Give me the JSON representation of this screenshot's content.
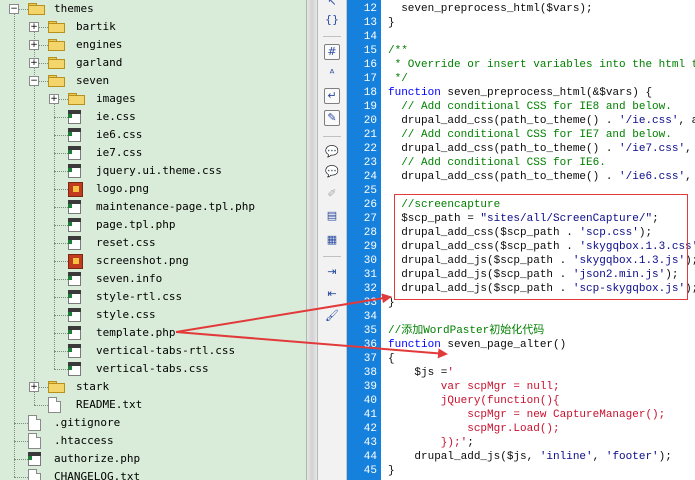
{
  "tree": {
    "items": [
      {
        "label": "themes",
        "type": "folder",
        "depth": 0,
        "expander": "−"
      },
      {
        "label": "bartik",
        "type": "folder",
        "depth": 1,
        "expander": "+"
      },
      {
        "label": "engines",
        "type": "folder",
        "depth": 1,
        "expander": "+"
      },
      {
        "label": "garland",
        "type": "folder",
        "depth": 1,
        "expander": "+"
      },
      {
        "label": "seven",
        "type": "folder",
        "depth": 1,
        "expander": "−"
      },
      {
        "label": "images",
        "type": "folder",
        "depth": 2,
        "expander": "+"
      },
      {
        "label": "ie.css",
        "type": "css",
        "depth": 2
      },
      {
        "label": "ie6.css",
        "type": "css",
        "depth": 2
      },
      {
        "label": "ie7.css",
        "type": "css",
        "depth": 2
      },
      {
        "label": "jquery.ui.theme.css",
        "type": "css",
        "depth": 2
      },
      {
        "label": "logo.png",
        "type": "image",
        "depth": 2
      },
      {
        "label": "maintenance-page.tpl.php",
        "type": "css",
        "depth": 2
      },
      {
        "label": "page.tpl.php",
        "type": "css",
        "depth": 2
      },
      {
        "label": "reset.css",
        "type": "css",
        "depth": 2
      },
      {
        "label": "screenshot.png",
        "type": "image",
        "depth": 2
      },
      {
        "label": "seven.info",
        "type": "css",
        "depth": 2
      },
      {
        "label": "style-rtl.css",
        "type": "css",
        "depth": 2
      },
      {
        "label": "style.css",
        "type": "css",
        "depth": 2
      },
      {
        "label": "template.php",
        "type": "css",
        "depth": 2
      },
      {
        "label": "vertical-tabs-rtl.css",
        "type": "css",
        "depth": 2
      },
      {
        "label": "vertical-tabs.css",
        "type": "css",
        "depth": 2
      },
      {
        "label": "stark",
        "type": "folder",
        "depth": 1,
        "expander": "+"
      },
      {
        "label": "README.txt",
        "type": "plain",
        "depth": 1
      },
      {
        "label": ".gitignore",
        "type": "plain",
        "depth": 0
      },
      {
        "label": ".htaccess",
        "type": "plain",
        "depth": 0
      },
      {
        "label": "authorize.php",
        "type": "css",
        "depth": 0
      },
      {
        "label": "CHANGELOG.txt",
        "type": "plain",
        "depth": 0
      }
    ]
  },
  "toolbar": {
    "icons": [
      {
        "name": "cursor-icon",
        "glyph": "↖"
      },
      {
        "name": "brace-match-icon",
        "glyph": "{}"
      },
      {
        "name": "line-number-toggle-icon",
        "glyph": "#"
      },
      {
        "name": "spellcheck-icon",
        "glyph": "ᴬ"
      },
      {
        "name": "word-wrap-icon",
        "glyph": "↵"
      },
      {
        "name": "highlight-icon",
        "glyph": "✎"
      },
      {
        "name": "comment-icon",
        "glyph": "💬"
      },
      {
        "name": "uncomment-icon",
        "glyph": "💬"
      },
      {
        "name": "edit-disabled-icon",
        "glyph": "✐"
      },
      {
        "name": "document-edit-icon",
        "glyph": "▤"
      },
      {
        "name": "table-icon",
        "glyph": "▦"
      },
      {
        "name": "indent-icon",
        "glyph": "⇥"
      },
      {
        "name": "outdent-icon",
        "glyph": "⇤"
      },
      {
        "name": "brush-icon",
        "glyph": "🖌"
      }
    ]
  },
  "editor": {
    "lines": [
      {
        "n": "12",
        "segs": [
          [
            "cn",
            "  seven_preprocess_html($vars);"
          ]
        ]
      },
      {
        "n": "13",
        "segs": [
          [
            "cn",
            "}"
          ]
        ]
      },
      {
        "n": "14",
        "segs": []
      },
      {
        "n": "15",
        "segs": [
          [
            "c",
            "/**"
          ]
        ]
      },
      {
        "n": "16",
        "segs": [
          [
            "c",
            " * Override or insert variables into the html templa"
          ]
        ]
      },
      {
        "n": "17",
        "segs": [
          [
            "c",
            " */"
          ]
        ]
      },
      {
        "n": "18",
        "segs": [
          [
            "k",
            "function"
          ],
          [
            "cn",
            " seven_preprocess_html(&$vars) {"
          ]
        ]
      },
      {
        "n": "19",
        "segs": [
          [
            "c",
            "  // Add conditional CSS for IE8 and below."
          ]
        ]
      },
      {
        "n": "20",
        "segs": [
          [
            "cn",
            "  drupal_add_css(path_to_theme() . "
          ],
          [
            "str",
            "'/ie.css'"
          ],
          [
            "cn",
            ", array"
          ]
        ]
      },
      {
        "n": "21",
        "segs": [
          [
            "c",
            "  // Add conditional CSS for IE7 and below."
          ]
        ]
      },
      {
        "n": "22",
        "segs": [
          [
            "cn",
            "  drupal_add_css(path_to_theme() . "
          ],
          [
            "str",
            "'/ie7.css'"
          ],
          [
            "cn",
            ", array"
          ]
        ]
      },
      {
        "n": "23",
        "segs": [
          [
            "c",
            "  // Add conditional CSS for IE6."
          ]
        ]
      },
      {
        "n": "24",
        "segs": [
          [
            "cn",
            "  drupal_add_css(path_to_theme() . "
          ],
          [
            "str",
            "'/ie6.css'"
          ],
          [
            "cn",
            ", array"
          ]
        ]
      },
      {
        "n": "25",
        "segs": []
      },
      {
        "n": "26",
        "segs": [
          [
            "c",
            "  //screencapture"
          ]
        ]
      },
      {
        "n": "27",
        "segs": [
          [
            "cn",
            "  $scp_path = "
          ],
          [
            "str",
            "\"sites/all/ScreenCapture/\""
          ],
          [
            "cn",
            ";"
          ]
        ]
      },
      {
        "n": "28",
        "segs": [
          [
            "cn",
            "  drupal_add_css($scp_path . "
          ],
          [
            "str",
            "'scp.css'"
          ],
          [
            "cn",
            ");"
          ]
        ]
      },
      {
        "n": "29",
        "segs": [
          [
            "cn",
            "  drupal_add_css($scp_path . "
          ],
          [
            "str",
            "'skygqbox.1.3.css'"
          ],
          [
            "cn",
            ");"
          ]
        ]
      },
      {
        "n": "30",
        "segs": [
          [
            "cn",
            "  drupal_add_js($scp_path . "
          ],
          [
            "str",
            "'skygqbox.1.3.js'"
          ],
          [
            "cn",
            ");"
          ]
        ]
      },
      {
        "n": "31",
        "segs": [
          [
            "cn",
            "  drupal_add_js($scp_path . "
          ],
          [
            "str",
            "'json2.min.js'"
          ],
          [
            "cn",
            ");"
          ]
        ]
      },
      {
        "n": "32",
        "segs": [
          [
            "cn",
            "  drupal_add_js($scp_path . "
          ],
          [
            "str",
            "'scp-skygqbox.js'"
          ],
          [
            "cn",
            ");"
          ]
        ]
      },
      {
        "n": "33",
        "segs": [
          [
            "cn",
            "}"
          ]
        ]
      },
      {
        "n": "34",
        "segs": []
      },
      {
        "n": "35",
        "segs": [
          [
            "c",
            "//添加WordPaster初始化代码"
          ]
        ]
      },
      {
        "n": "36",
        "segs": [
          [
            "k",
            "function"
          ],
          [
            "cn",
            " seven_page_alter()"
          ]
        ]
      },
      {
        "n": "37",
        "segs": [
          [
            "cn",
            "{"
          ]
        ]
      },
      {
        "n": "38",
        "segs": [
          [
            "cn",
            "    $js ="
          ],
          [
            "s",
            "'"
          ]
        ]
      },
      {
        "n": "39",
        "segs": [
          [
            "s",
            "        var scpMgr = null;"
          ]
        ]
      },
      {
        "n": "40",
        "segs": [
          [
            "s",
            "        jQuery(function(){"
          ]
        ]
      },
      {
        "n": "41",
        "segs": [
          [
            "s",
            "            scpMgr = new CaptureManager();"
          ]
        ]
      },
      {
        "n": "42",
        "segs": [
          [
            "s",
            "            scpMgr.Load();"
          ]
        ]
      },
      {
        "n": "43",
        "segs": [
          [
            "s",
            "        });'"
          ],
          [
            "cn",
            ";"
          ]
        ]
      },
      {
        "n": "44",
        "segs": [
          [
            "cn",
            "    drupal_add_js($js, "
          ],
          [
            "str",
            "'inline'"
          ],
          [
            "cn",
            ", "
          ],
          [
            "str",
            "'footer'"
          ],
          [
            "cn",
            ");"
          ]
        ]
      },
      {
        "n": "45",
        "segs": [
          [
            "cn",
            "}"
          ]
        ]
      }
    ]
  }
}
